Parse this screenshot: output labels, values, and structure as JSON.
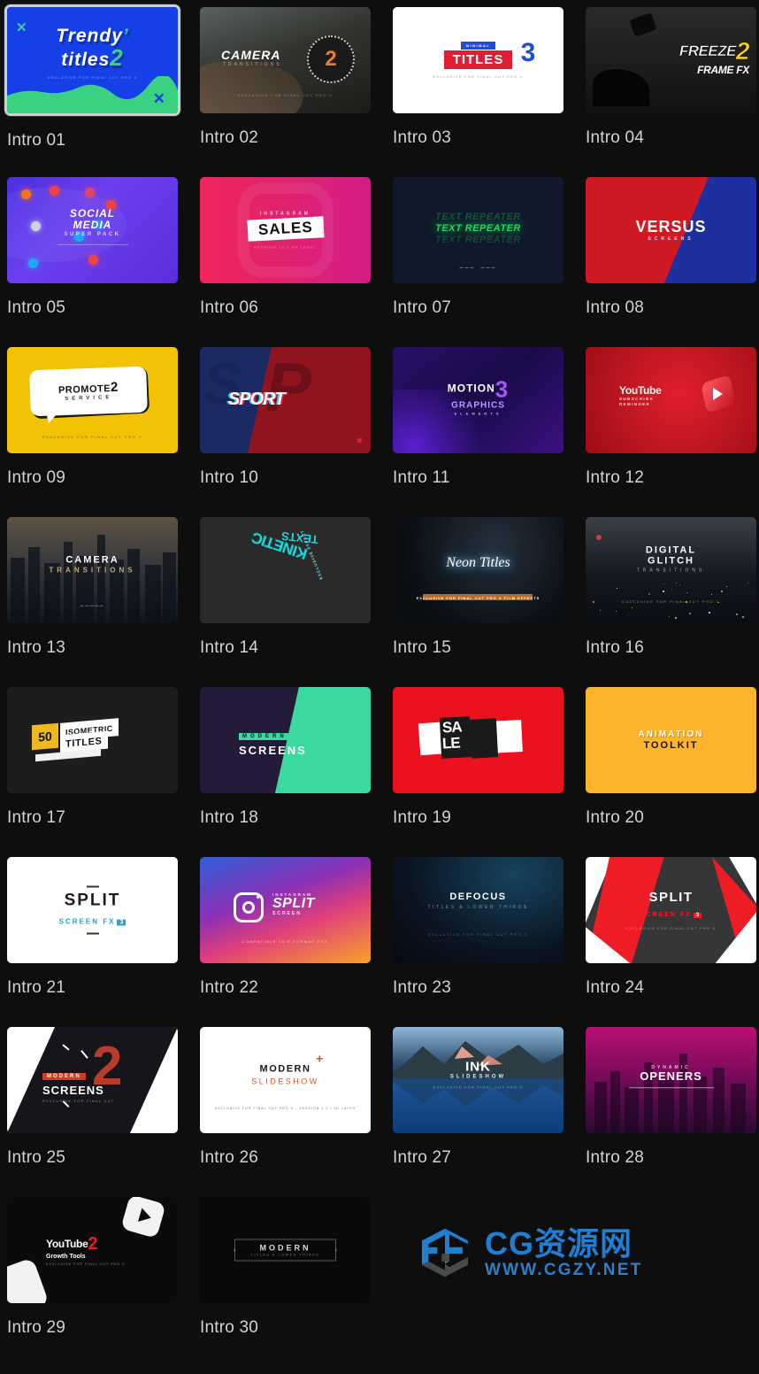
{
  "gallery": {
    "columns": 4,
    "selected_index": 0,
    "items": [
      {
        "label": "Intro 01",
        "art": "trendy-titles",
        "title": "Trendy titles",
        "badge": "2",
        "subtitle": "EXCLUSIVE FOR FINAL CUT PRO X"
      },
      {
        "label": "Intro 02",
        "art": "camera-transitions-2",
        "title": "CAMERA",
        "sub": "TRANSITIONS",
        "badge": "2",
        "subtitle": "EXCLUSIVE FOR FINAL CUT PRO X"
      },
      {
        "label": "Intro 03",
        "art": "minimal-titles-3",
        "title": "TITLES",
        "kicker": "MINIMAL",
        "badge": "3",
        "subtitle": "EXCLUSIVE FOR FINAL CUT PRO X"
      },
      {
        "label": "Intro 04",
        "art": "freeze-frame-fx-2",
        "title": "FREEZE",
        "sub": "FRAME FX",
        "badge": "2"
      },
      {
        "label": "Intro 05",
        "art": "social-media-pack",
        "title": "SOCIAL MEDIA",
        "sub": "SUPER PACK"
      },
      {
        "label": "Intro 06",
        "art": "instagram-sales",
        "kicker": "INSTAGRAM",
        "title": "SALES",
        "subtitle": "FASHION 16:9 4K LEVEL"
      },
      {
        "label": "Intro 07",
        "art": "text-repeater",
        "title": "TEXT REPEATER"
      },
      {
        "label": "Intro 08",
        "art": "versus-screens",
        "title": "VERSUS",
        "sub": "SCREENS"
      },
      {
        "label": "Intro 09",
        "art": "promote-service-2",
        "title": "PROMOTE",
        "sub": "SERVICE",
        "badge": "2",
        "subtitle": "EXCLUSIVE FOR FINAL CUT PRO X"
      },
      {
        "label": "Intro 10",
        "art": "sport-glitch",
        "title": "SPORT"
      },
      {
        "label": "Intro 11",
        "art": "motion-graphics-3",
        "title": "MOTION",
        "sub": "GRAPHICS",
        "sub2": "ELEMENTS",
        "badge": "3"
      },
      {
        "label": "Intro 12",
        "art": "youtube-subscribe",
        "title": "YouTube",
        "sub": "SUBSCRIBE REMINDER"
      },
      {
        "label": "Intro 13",
        "art": "camera-transitions-city",
        "title": "CAMERA",
        "sub": "TRANSITIONS"
      },
      {
        "label": "Intro 14",
        "art": "kinetic-texts",
        "title": "KINETIC",
        "sub": "TEXTS",
        "kicker": "EXCLUSIVE EFFECT"
      },
      {
        "label": "Intro 15",
        "art": "neon-titles",
        "title": "Neon Titles",
        "subtitle": "EXCLUSIVE FOR FINAL CUT PRO X  FILM EFFECTS"
      },
      {
        "label": "Intro 16",
        "art": "digital-glitch",
        "title": "DIGITAL",
        "sub": "GLITCH",
        "sub2": "TRANSITIONS",
        "subtitle": "EXCLUSIVE FOR FINAL CUT PRO X"
      },
      {
        "label": "Intro 17",
        "art": "isometric-titles",
        "badge": "50",
        "title": "ISOMETRIC",
        "sub": "TITLES"
      },
      {
        "label": "Intro 18",
        "art": "modern-screens",
        "kicker": "MODERN",
        "title": "SCREENS"
      },
      {
        "label": "Intro 19",
        "art": "sale-blocks",
        "title": "SALE"
      },
      {
        "label": "Intro 20",
        "art": "animation-toolkit",
        "title": "ANIMATION",
        "sub": "TOOLKIT"
      },
      {
        "label": "Intro 21",
        "art": "split-screen-fx-3",
        "title": "SPLIT",
        "sub": "SCREEN FX",
        "badge": "3"
      },
      {
        "label": "Intro 22",
        "art": "instagram-split-screen",
        "kicker": "INSTAGRAM",
        "title": "SPLIT",
        "sub": "SCREEN",
        "subtitle": "COMPATIBLE 16:9 FORMAT PRO"
      },
      {
        "label": "Intro 23",
        "art": "defocus-titles",
        "title": "DEFOCUS",
        "sub": "TITLES & LOWER THIRDS",
        "subtitle": "EXCLUSIVE FOR FINAL CUT PRO X"
      },
      {
        "label": "Intro 24",
        "art": "split-screen-fx-red",
        "title": "SPLIT",
        "sub": "SCREEN FX",
        "badge": "3",
        "subtitle": "EXCLUSIVE FOR FINAL CUT PRO X"
      },
      {
        "label": "Intro 25",
        "art": "modern-screens-2",
        "kicker": "MODERN",
        "title": "SCREENS",
        "badge": "2",
        "subtitle": "EXCLUSIVE FOR FINAL CUT"
      },
      {
        "label": "Intro 26",
        "art": "modern-slideshow",
        "title": "MODERN",
        "sub": "SLIDESHOW",
        "badge": "+",
        "subtitle": "EXCLUSIVE FOR FINAL CUT PRO X  -  VERSION 1.2 / 4K LAYER"
      },
      {
        "label": "Intro 27",
        "art": "ink-slideshow",
        "title": "INK",
        "sub": "SLIDESHOW",
        "subtitle": "EXCLUSIVE FOR FINAL CUT PRO X"
      },
      {
        "label": "Intro 28",
        "art": "dynamic-openers",
        "kicker": "DYNAMIC",
        "title": "OPENERS"
      },
      {
        "label": "Intro 29",
        "art": "youtube-growth-tools-2",
        "title": "YouTube",
        "sub": "Growth Tools",
        "badge": "2",
        "subtitle": "EXCLUSIVE FOR FINAL CUT PRO X"
      },
      {
        "label": "Intro 30",
        "art": "modern-titles-lower",
        "title": "MODERN",
        "sub": "TITLES & LOWER THIRDS"
      }
    ]
  },
  "watermark": {
    "logo_name": "cg-cube-logo",
    "brand_cn": "CG资源网",
    "brand_url": "WWW.CGZY.NET",
    "color": "#2080d0"
  },
  "theme": {
    "background": "#0e0e0e",
    "label_color": "#d3d3d3",
    "selection_border": "#cfcfcf"
  }
}
